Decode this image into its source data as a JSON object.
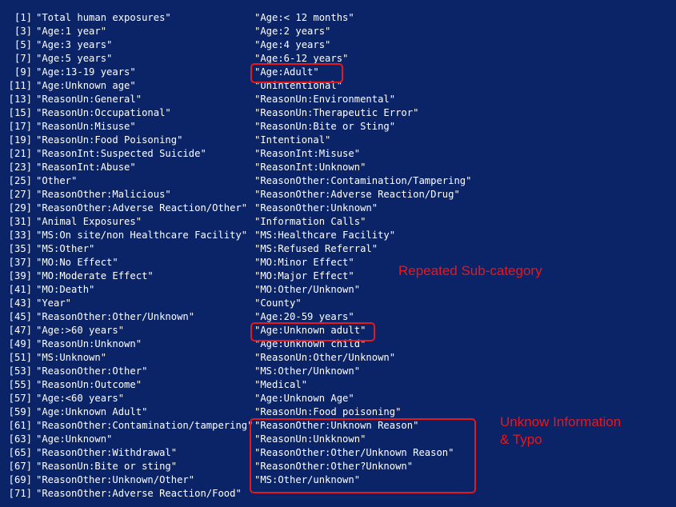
{
  "rows": [
    {
      "index": "[1]",
      "left": "\"Total human exposures\"",
      "right": "\"Age:< 12 months\""
    },
    {
      "index": "[3]",
      "left": "\"Age:1 year\"",
      "right": "\"Age:2 years\""
    },
    {
      "index": "[5]",
      "left": "\"Age:3 years\"",
      "right": "\"Age:4 years\""
    },
    {
      "index": "[7]",
      "left": "\"Age:5 years\"",
      "right": "\"Age:6-12 years\""
    },
    {
      "index": "[9]",
      "left": "\"Age:13-19 years\"",
      "right": "\"Age:Adult\""
    },
    {
      "index": "[11]",
      "left": "\"Age:Unknown age\"",
      "right": "\"Unintentional\""
    },
    {
      "index": "[13]",
      "left": "\"ReasonUn:General\"",
      "right": "\"ReasonUn:Environmental\""
    },
    {
      "index": "[15]",
      "left": "\"ReasonUn:Occupational\"",
      "right": "\"ReasonUn:Therapeutic Error\""
    },
    {
      "index": "[17]",
      "left": "\"ReasonUn:Misuse\"",
      "right": "\"ReasonUn:Bite or Sting\""
    },
    {
      "index": "[19]",
      "left": "\"ReasonUn:Food Poisoning\"",
      "right": "\"Intentional\""
    },
    {
      "index": "[21]",
      "left": "\"ReasonInt:Suspected Suicide\"",
      "right": "\"ReasonInt:Misuse\""
    },
    {
      "index": "[23]",
      "left": "\"ReasonInt:Abuse\"",
      "right": "\"ReasonInt:Unknown\""
    },
    {
      "index": "[25]",
      "left": "\"Other\"",
      "right": "\"ReasonOther:Contamination/Tampering\""
    },
    {
      "index": "[27]",
      "left": "\"ReasonOther:Malicious\"",
      "right": "\"ReasonOther:Adverse Reaction/Drug\""
    },
    {
      "index": "[29]",
      "left": "\"ReasonOther:Adverse Reaction/Other\"",
      "right": "\"ReasonOther:Unknown\""
    },
    {
      "index": "[31]",
      "left": "\"Animal Exposures\"",
      "right": "\"Information Calls\""
    },
    {
      "index": "[33]",
      "left": "\"MS:On site/non Healthcare Facility\"",
      "right": "\"MS:Healthcare Facility\""
    },
    {
      "index": "[35]",
      "left": "\"MS:Other\"",
      "right": "\"MS:Refused Referral\""
    },
    {
      "index": "[37]",
      "left": "\"MO:No Effect\"",
      "right": "\"MO:Minor Effect\""
    },
    {
      "index": "[39]",
      "left": "\"MO:Moderate Effect\"",
      "right": "\"MO:Major Effect\""
    },
    {
      "index": "[41]",
      "left": "\"MO:Death\"",
      "right": "\"MO:Other/Unknown\""
    },
    {
      "index": "[43]",
      "left": "\"Year\"",
      "right": "\"County\""
    },
    {
      "index": "[45]",
      "left": "\"ReasonOther:Other/Unknown\"",
      "right": "\"Age:20-59 years\""
    },
    {
      "index": "[47]",
      "left": "\"Age:>60 years\"",
      "right": "\"Age:Unknown adult\""
    },
    {
      "index": "[49]",
      "left": "\"ReasonUn:Unknown\"",
      "right": "\"Age:Unknown child\""
    },
    {
      "index": "[51]",
      "left": "\"MS:Unknown\"",
      "right": "\"ReasonUn:Other/Unknown\""
    },
    {
      "index": "[53]",
      "left": "\"ReasonOther:Other\"",
      "right": "\"MS:Other/Unknown\""
    },
    {
      "index": "[55]",
      "left": "\"ReasonUn:Outcome\"",
      "right": "\"Medical\""
    },
    {
      "index": "[57]",
      "left": "\"Age:<60 years\"",
      "right": "\"Age:Unknown Age\""
    },
    {
      "index": "[59]",
      "left": "\"Age:Unknown Adult\"",
      "right": "\"ReasonUn:Food poisoning\""
    },
    {
      "index": "[61]",
      "left": "\"ReasonOther:Contamination/tampering\"",
      "right": "\"ReasonOther:Unknown Reason\""
    },
    {
      "index": "[63]",
      "left": "\"Age:Unknown\"",
      "right": "\"ReasonUn:Unkknown\""
    },
    {
      "index": "[65]",
      "left": "\"ReasonOther:Withdrawal\"",
      "right": "\"ReasonOther:Other/Unknown Reason\""
    },
    {
      "index": "[67]",
      "left": "\"ReasonUn:Bite or sting\"",
      "right": "\"ReasonOther:Other?Unknown\""
    },
    {
      "index": "[69]",
      "left": "\"ReasonOther:Unknown/Other\"",
      "right": "\"MS:Other/unknown\""
    },
    {
      "index": "[71]",
      "left": "\"ReasonOther:Adverse Reaction/Food\"",
      "right": ""
    }
  ],
  "annotations": {
    "repeated_label": "Repeated Sub-category",
    "unknown_label": "Unknow Information\n& Typo"
  },
  "colors": {
    "background": "#0b2467",
    "text": "#ffffff",
    "annotation": "#e8171c"
  }
}
